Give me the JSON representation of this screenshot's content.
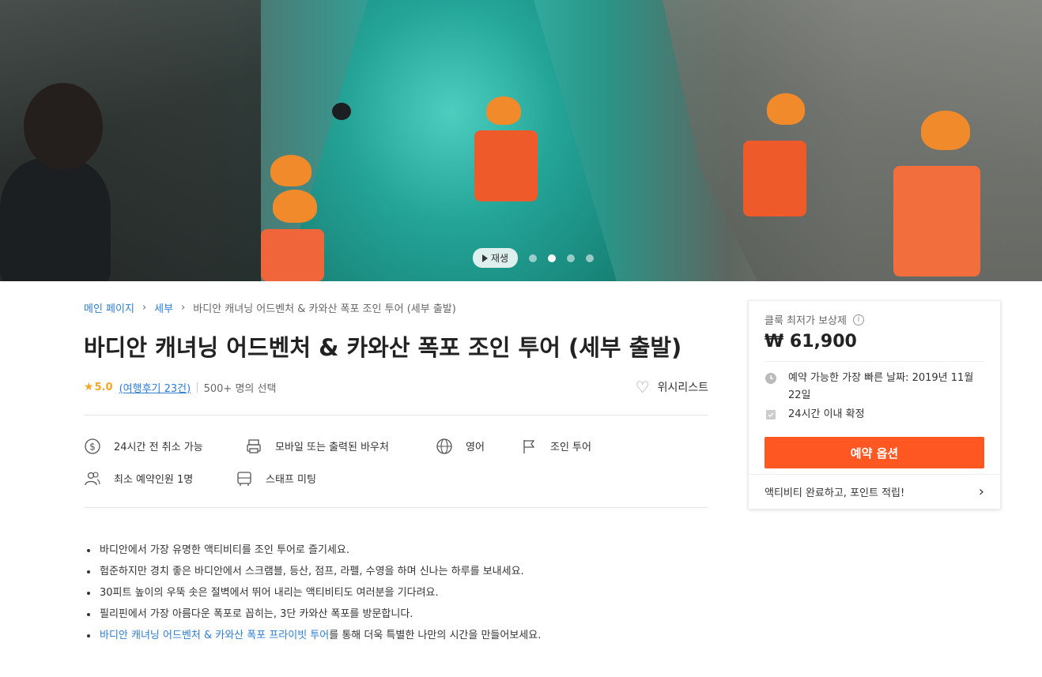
{
  "hero": {
    "play_label": "재생",
    "dots": 4,
    "active_dot": 2
  },
  "breadcrumb": {
    "items": [
      "메인 페이지",
      "세부"
    ],
    "current": "바디안 캐녀닝 어드벤처 & 카와산 폭포 조인 투어 (세부 출발)"
  },
  "title": "바디안 캐녀닝 어드벤처 & 카와산 폭포 조인 투어 (세부 출발)",
  "rating": {
    "star": "★",
    "score": "5.0",
    "reviews": "(여행후기 23건)",
    "separator": "|",
    "chosen": "500+ 명의 선택"
  },
  "wishlist_label": "위시리스트",
  "features": {
    "cancel": "24시간 전 취소 가능",
    "voucher": "모바일 또는 출력된 바우처",
    "language": "영어",
    "tour_type": "조인 투어",
    "min_people": "최소 예약인원 1명",
    "meeting": "스태프 미팅"
  },
  "bullets": [
    "바디안에서 가장 유명한 액티비티를 조인 투어로 즐기세요.",
    "험준하지만 경치 좋은 바디안에서 스크램블, 등산, 점프, 라펠, 수영을 하며 신나는 하루를 보내세요.",
    "30피트 높이의 우뚝 솟은 절벽에서 뛰어 내리는 액티비티도 여러분을 기다려요.",
    "필리핀에서 가장 아름다운 폭포로 꼽히는, 3단 카와산 폭포를 방문합니다."
  ],
  "last_bullet": {
    "link": "바디안 캐녀닝 어드벤처 & 카와산 폭포 프라이빗 투어",
    "rest": "를 통해 더욱 특별한 나만의 시간을 만들어보세요."
  },
  "sidebar": {
    "guarantee": "클룩 최저가 보상제",
    "info": "i",
    "price": "₩ 61,900",
    "earliest_date": "예약 가능한 가장 빠른 날짜: 2019년 11월 22일",
    "confirm": "24시간 이내 확정",
    "book_button": "예약 옵션",
    "points": "액티비티 완료하고, 포인트 적립!",
    "points_chevron": "›"
  },
  "colors": {
    "accent": "#ff5722",
    "link": "#2d7dd2",
    "star": "#f5a623"
  }
}
